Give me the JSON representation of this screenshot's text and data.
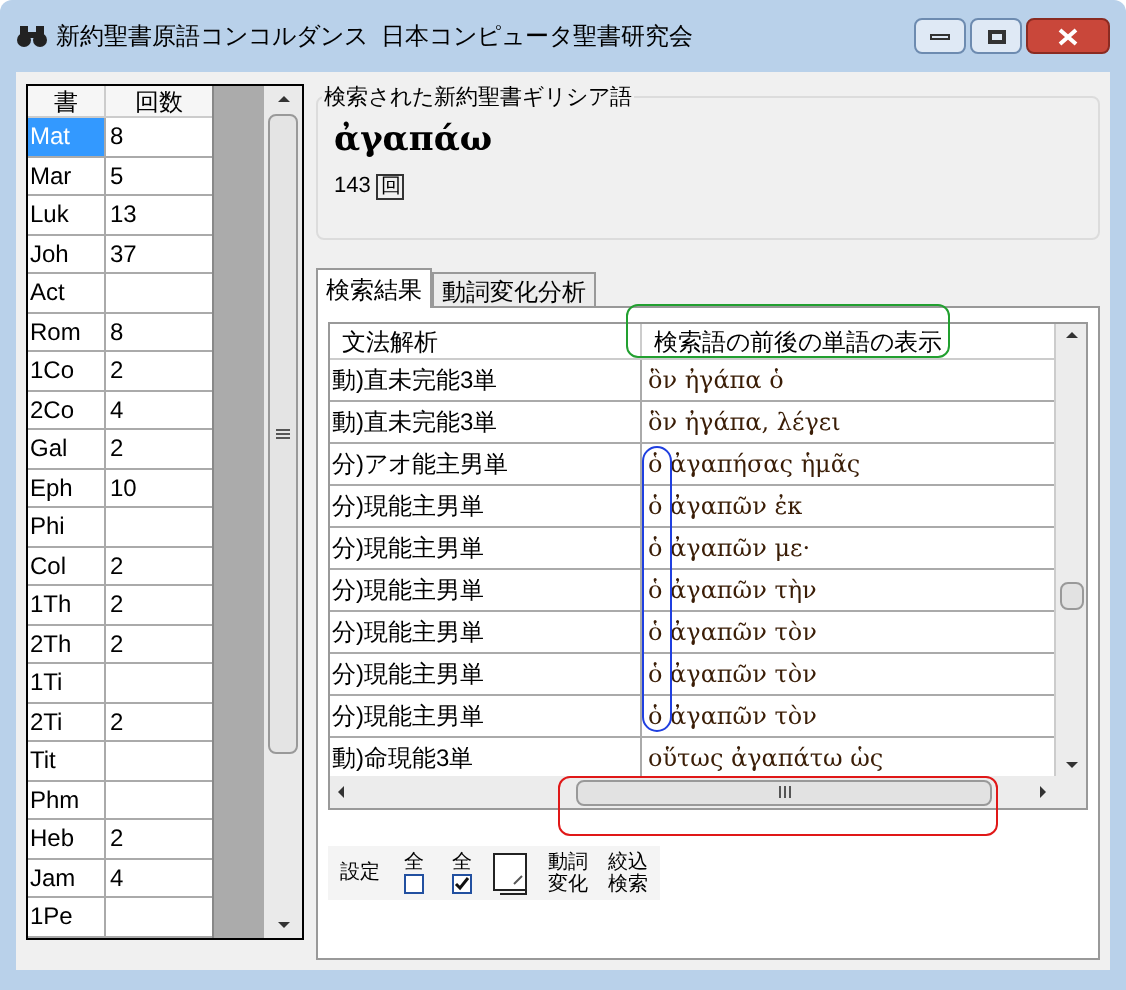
{
  "window": {
    "title": "新約聖書原語コンコルダンス  日本コンピュータ聖書研究会"
  },
  "book_list": {
    "columns": [
      "書",
      "回数"
    ],
    "rows": [
      {
        "book": "Mat",
        "count": "8",
        "selected": true
      },
      {
        "book": "Mar",
        "count": "5",
        "selected": false
      },
      {
        "book": "Luk",
        "count": "13",
        "selected": false
      },
      {
        "book": "Joh",
        "count": "37",
        "selected": false
      },
      {
        "book": "Act",
        "selected": false
      },
      {
        "book": "Rom",
        "count": "8",
        "selected": false
      },
      {
        "book": "1Co",
        "count": "2",
        "selected": false
      },
      {
        "book": "2Co",
        "count": "4",
        "selected": false
      },
      {
        "book": "Gal",
        "count": "2",
        "selected": false
      },
      {
        "book": "Eph",
        "count": "10",
        "selected": false
      },
      {
        "book": "Phi",
        "selected": false
      },
      {
        "book": "Col",
        "count": "2",
        "selected": false
      },
      {
        "book": "1Th",
        "count": "2",
        "selected": false
      },
      {
        "book": "2Th",
        "count": "2",
        "selected": false
      },
      {
        "book": "1Ti",
        "selected": false
      },
      {
        "book": "2Ti",
        "count": "2",
        "selected": false
      },
      {
        "book": "Tit",
        "selected": false
      },
      {
        "book": "Phm",
        "selected": false
      },
      {
        "book": "Heb",
        "count": "2",
        "selected": false
      },
      {
        "book": "Jam",
        "count": "4",
        "selected": false
      },
      {
        "book": "1Pe",
        "selected": false
      }
    ]
  },
  "search_word": {
    "group_title": "検索された新約聖書ギリシア語",
    "word": "ἀγαπάω",
    "count": "143",
    "unit": "回"
  },
  "tabs": [
    {
      "label": "検索結果",
      "selected": true
    },
    {
      "label": "動詞変化分析",
      "selected": false
    }
  ],
  "results": {
    "columns": [
      "文法解析",
      "検索語の前後の単語の表示"
    ],
    "rows": [
      {
        "parse": "動)直未完能3単",
        "context": "ὃν ἠγάπα ὁ"
      },
      {
        "parse": "動)直未完能3単",
        "context": "ὃν ἠγάπα, λέγει"
      },
      {
        "parse": "分)アオ能主男単",
        "context": "ὁ ἀγαπήσας ἡμᾶς"
      },
      {
        "parse": "分)現能主男単",
        "context": "ὁ ἀγαπῶν ἐκ"
      },
      {
        "parse": "分)現能主男単",
        "context": "ὁ ἀγαπῶν με·"
      },
      {
        "parse": "分)現能主男単",
        "context": "ὁ ἀγαπῶν τὴν"
      },
      {
        "parse": "分)現能主男単",
        "context": "ὁ ἀγαπῶν τὸν"
      },
      {
        "parse": "分)現能主男単",
        "context": "ὁ ἀγαπῶν τὸν"
      },
      {
        "parse": "分)現能主男単",
        "context": "ὁ ἀγαπῶν τὸν"
      },
      {
        "parse": "動)命現能3単",
        "context": "οὕτως ἀγαπάτω ὡς"
      }
    ]
  },
  "toolbar": [
    {
      "kind": "text",
      "label": "設定"
    },
    {
      "kind": "checkbox",
      "label": "全",
      "checked": false
    },
    {
      "kind": "checkbox",
      "label": "全",
      "checked": true
    },
    {
      "kind": "page"
    },
    {
      "kind": "text",
      "label": "動詞変化"
    },
    {
      "kind": "text",
      "label": "絞込検索"
    }
  ]
}
